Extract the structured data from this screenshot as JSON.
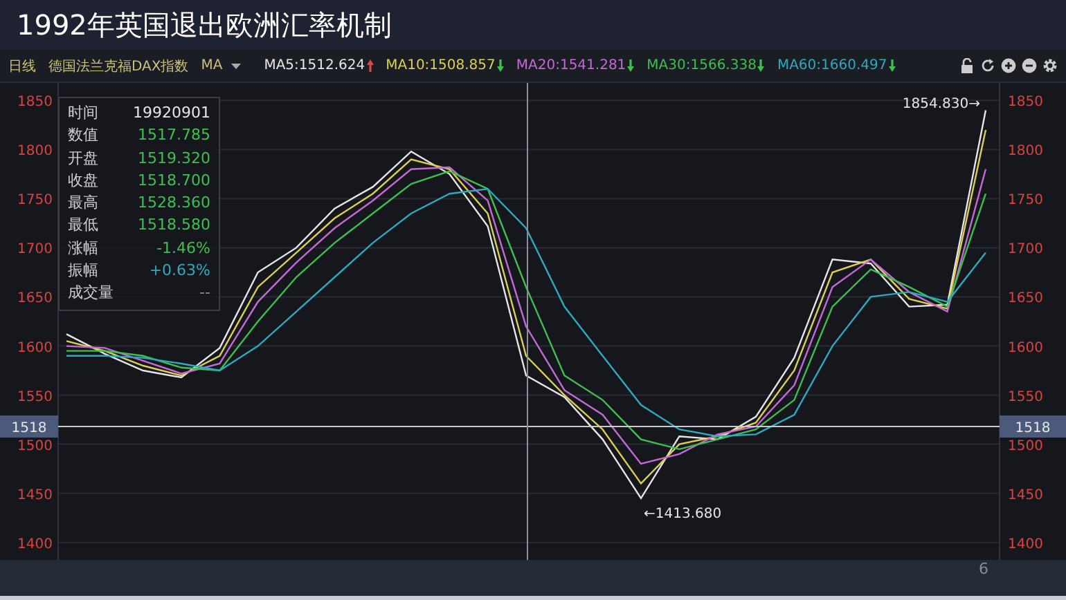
{
  "title": "1992年英国退出欧洲汇率机制",
  "toolbar": {
    "period": "日线",
    "instrument": "德国法兰克福DAX指数",
    "indicator": "MA",
    "trend_arrows": [
      {
        "rising": true
      },
      {
        "rising": false
      },
      {
        "rising": false
      },
      {
        "rising": false
      },
      {
        "rising": false
      }
    ]
  },
  "info_panel": [
    {
      "label": "时间",
      "value": "19920901",
      "color": "#e6e6e6"
    },
    {
      "label": "数值",
      "value": "1517.785",
      "color": "#3fbf4f"
    },
    {
      "label": "开盘",
      "value": "1519.320",
      "color": "#3fbf4f"
    },
    {
      "label": "收盘",
      "value": "1518.700",
      "color": "#3fbf4f"
    },
    {
      "label": "最高",
      "value": "1528.360",
      "color": "#3fbf4f"
    },
    {
      "label": "最低",
      "value": "1518.580",
      "color": "#3fbf4f"
    },
    {
      "label": "涨幅",
      "value": "-1.46%",
      "color": "#3fbf4f"
    },
    {
      "label": "振幅",
      "value": "+0.63%",
      "color": "#2ea9bd"
    },
    {
      "label": "成交量",
      "value": "--",
      "color": "#8a8a8a"
    }
  ],
  "chart_data": {
    "type": "line",
    "grid": true,
    "ylim": [
      1385,
      1865
    ],
    "yticks": [
      1850,
      1800,
      1750,
      1700,
      1650,
      1600,
      1550,
      1500,
      1450,
      1400
    ],
    "series": [
      {
        "name": "MA5:1512.624",
        "color": "#e6e6e6",
        "values": [
          1612,
          1592,
          1575,
          1568,
          1598,
          1675,
          1700,
          1740,
          1762,
          1798,
          1775,
          1722,
          1570,
          1548,
          1505,
          1445,
          1508,
          1505,
          1528,
          1588,
          1688,
          1684,
          1640,
          1642,
          1840
        ]
      },
      {
        "name": "MA10:1508.857",
        "color": "#dccf52",
        "values": [
          1605,
          1595,
          1580,
          1570,
          1590,
          1660,
          1695,
          1730,
          1755,
          1790,
          1780,
          1735,
          1590,
          1550,
          1515,
          1460,
          1500,
          1508,
          1522,
          1575,
          1675,
          1688,
          1648,
          1638,
          1820
        ]
      },
      {
        "name": "MA20:1541.281",
        "color": "#c46ad6",
        "values": [
          1600,
          1598,
          1585,
          1572,
          1582,
          1645,
          1685,
          1720,
          1748,
          1780,
          1782,
          1748,
          1620,
          1555,
          1530,
          1480,
          1490,
          1510,
          1518,
          1560,
          1660,
          1688,
          1655,
          1635,
          1780
        ]
      },
      {
        "name": "MA30:1566.338",
        "color": "#3fbf4f",
        "values": [
          1595,
          1595,
          1590,
          1578,
          1575,
          1625,
          1670,
          1705,
          1735,
          1765,
          1778,
          1760,
          1660,
          1570,
          1545,
          1505,
          1495,
          1505,
          1515,
          1545,
          1640,
          1678,
          1660,
          1640,
          1755
        ]
      },
      {
        "name": "MA60:1660.497",
        "color": "#2ea9bd",
        "values": [
          1590,
          1590,
          1588,
          1582,
          1575,
          1600,
          1635,
          1670,
          1705,
          1735,
          1755,
          1760,
          1720,
          1640,
          1590,
          1540,
          1515,
          1508,
          1510,
          1530,
          1600,
          1650,
          1655,
          1645,
          1695
        ]
      }
    ],
    "annotations": [
      {
        "text": "1854.830→"
      },
      {
        "text": "←1413.680"
      }
    ],
    "ref_lines": [
      {
        "axis": "y",
        "value": 1518
      }
    ]
  },
  "right_axis_labels": [
    "1850",
    "1800",
    "1750",
    "1700",
    "1650",
    "1600",
    "1550",
    "1500",
    "1450",
    "1400"
  ],
  "crosshair_labels": [
    "1518",
    "1518"
  ],
  "page_number": "6"
}
